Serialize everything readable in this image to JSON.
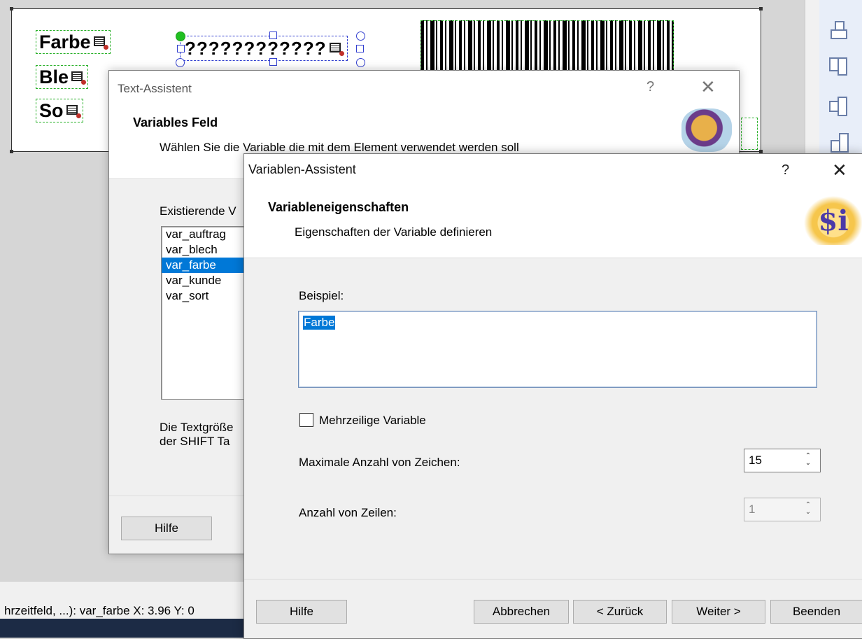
{
  "label_canvas": {
    "fields": [
      "Farbe",
      "Ble",
      "So"
    ],
    "selected_field_text": "????????????"
  },
  "status_bar": {
    "text": "hrzeitfeld, ...): var_farbe  X:  3.96 Y:  0"
  },
  "text_dialog": {
    "title": "Text-Assistent",
    "help_symbol": "?",
    "close_symbol": "✕",
    "header_title": "Variables Feld",
    "header_subtitle": "Wählen Sie die Variable die mit dem Element verwendet werden soll",
    "list_label": "Existierende V",
    "variables": [
      "var_auftrag",
      "var_blech",
      "var_farbe",
      "var_kunde",
      "var_sort"
    ],
    "selected_variable": "var_farbe",
    "hint_line1": "Die Textgröße",
    "hint_line2": "der SHIFT Ta",
    "help_button": "Hilfe"
  },
  "variable_dialog": {
    "title": "Variablen-Assistent",
    "help_symbol": "?",
    "close_symbol": "✕",
    "header_title": "Variableneigenschaften",
    "header_subtitle": "Eigenschaften der Variable definieren",
    "logo_text": "$i",
    "example_label": "Beispiel:",
    "example_value": "Farbe",
    "multiline_label": "Mehrzeilige Variable",
    "multiline_checked": false,
    "max_chars_label": "Maximale Anzahl von Zeichen:",
    "max_chars_value": "15",
    "rows_label": "Anzahl von Zeilen:",
    "rows_value": "1",
    "buttons": {
      "help": "Hilfe",
      "cancel": "Abbrechen",
      "back": "< Zurück",
      "next": "Weiter >",
      "finish": "Beenden"
    }
  }
}
